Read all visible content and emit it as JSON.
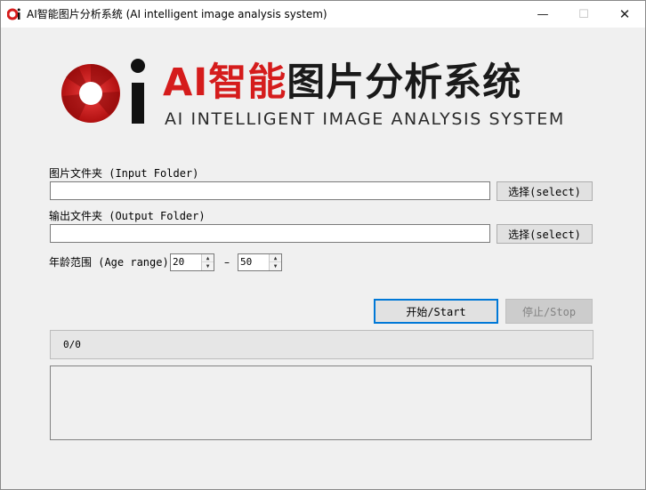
{
  "window": {
    "title": "AI智能图片分析系统 (AI intelligent image analysis system)",
    "minimize_symbol": "—",
    "maximize_symbol": "☐",
    "close_symbol": "✕"
  },
  "brand": {
    "title_red": "AI智能",
    "title_dark": "图片分析系统",
    "subtitle": "AI INTELLIGENT IMAGE ANALYSIS SYSTEM",
    "colors": {
      "red": "#d51c1c",
      "dark": "#1a1a1a"
    }
  },
  "input_folder": {
    "label": "图片文件夹 (Input Folder)",
    "value": "",
    "select_label": "选择(select)"
  },
  "output_folder": {
    "label": "输出文件夹 (Output Folder)",
    "value": "",
    "select_label": "选择(select)"
  },
  "age_range": {
    "label": "年龄范围 (Age range)",
    "min": "20",
    "separator": "–",
    "max": "50"
  },
  "actions": {
    "start_label": "开始/Start",
    "stop_label": "停止/Stop"
  },
  "progress": {
    "text": "0/0"
  },
  "icons": {
    "app": "app-logo-icon",
    "spin_up": "spin-up-icon",
    "spin_down": "spin-down-icon"
  }
}
